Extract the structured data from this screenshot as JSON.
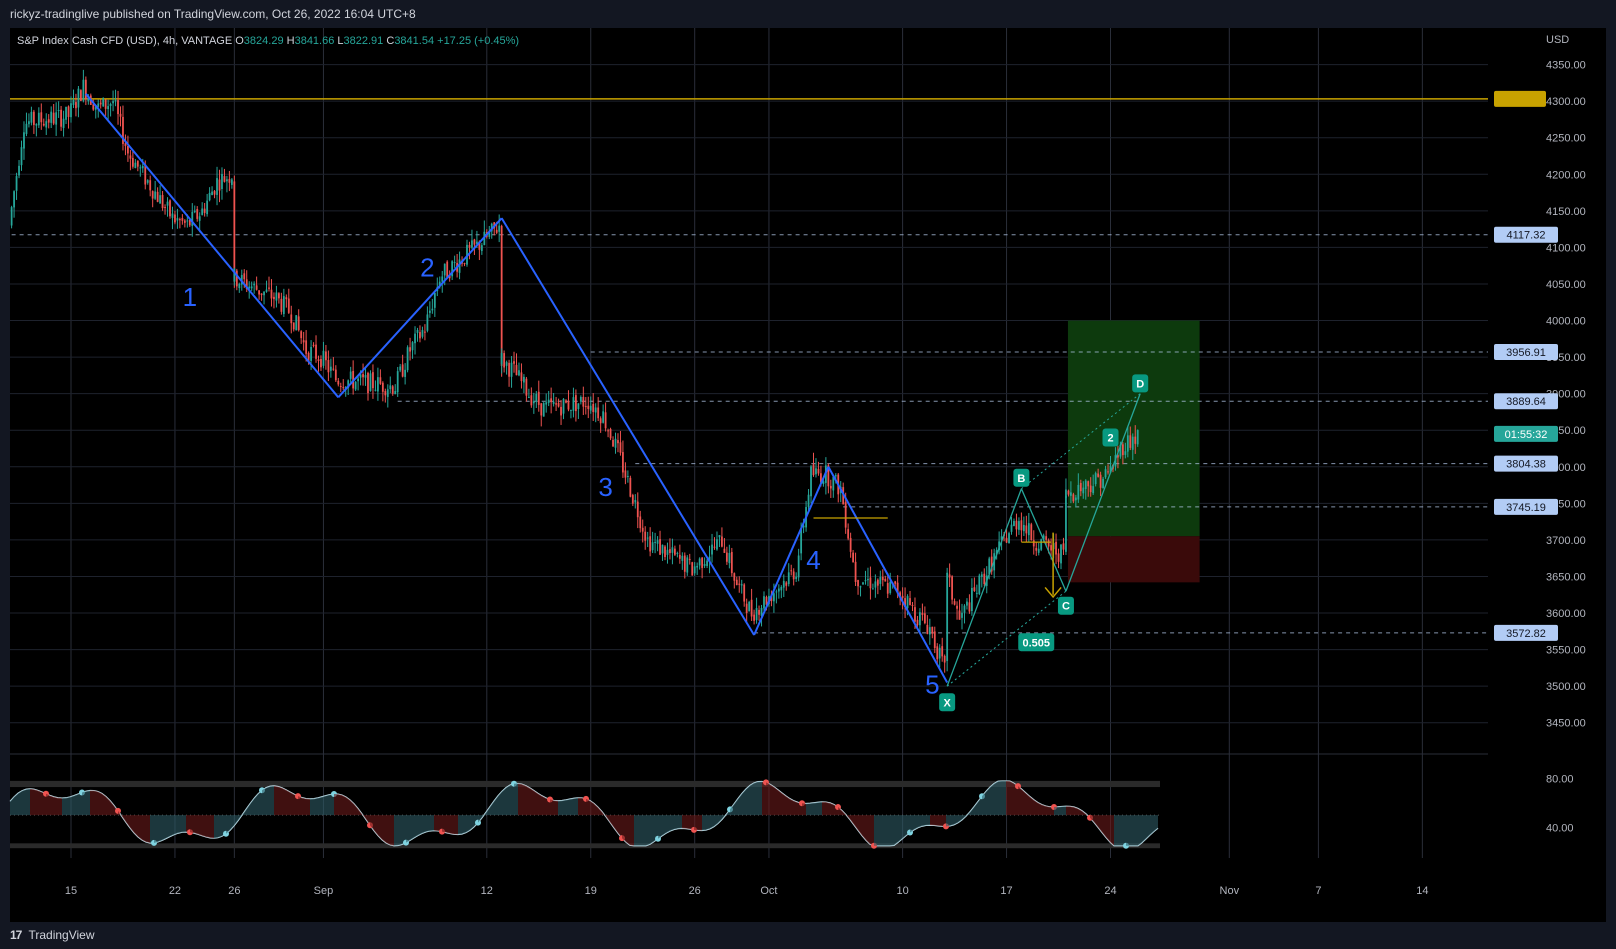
{
  "header": {
    "publish_text": "rickyz-tradinglive published on TradingView.com, Oct 26, 2022 16:04 UTC+8"
  },
  "footer": {
    "brand": "TradingView"
  },
  "legend": {
    "symbol": "S&P Index Cash CFD (USD), 4h, VANTAGE",
    "open_label": "O",
    "open": "3824.29",
    "high_label": "H",
    "high": "3841.66",
    "low_label": "L",
    "low": "3822.91",
    "close_label": "C",
    "close": "3841.54",
    "change": "+17.25 (+0.45%)"
  },
  "colors": {
    "background": "#000000",
    "up": "#26a69a",
    "down": "#ef5350",
    "wave_line": "#2962ff",
    "horizontal_gold": "#c8a200",
    "dashed_level": "#b2c7e8",
    "green_zone": "#0d3a0d",
    "red_zone": "#3a0a0a",
    "label_green": "#089981"
  },
  "chart_data": {
    "type": "candlestick",
    "currency": "USD",
    "y_ticks": [
      "4350.00",
      "4300.00",
      "4250.00",
      "4200.00",
      "4150.00",
      "4100.00",
      "4050.00",
      "4000.00",
      "3950.00",
      "3900.00",
      "3850.00",
      "3800.00",
      "3750.00",
      "3700.00",
      "3650.00",
      "3600.00",
      "3550.00",
      "3500.00",
      "3450.00"
    ],
    "ylim": [
      3410,
      4400
    ],
    "x_ticks": [
      "15",
      "22",
      "26",
      "Sep",
      "12",
      "19",
      "26",
      "Oct",
      "10",
      "17",
      "24",
      "Nov",
      "7",
      "14"
    ],
    "price_path": [
      [
        "Aug 11",
        4130
      ],
      [
        "Aug 12",
        4270
      ],
      [
        "Aug 15",
        4280
      ],
      [
        "Aug 16",
        4320
      ],
      [
        "Aug 17",
        4290
      ],
      [
        "Aug 18",
        4300
      ],
      [
        "Aug 19",
        4230
      ],
      [
        "Aug 22",
        4140
      ],
      [
        "Aug 23",
        4130
      ],
      [
        "Aug 24",
        4150
      ],
      [
        "Aug 25",
        4190
      ],
      [
        "Aug 26",
        4200
      ],
      [
        "Aug 26",
        4060
      ],
      [
        "Aug 29",
        4030
      ],
      [
        "Aug 30",
        4010
      ],
      [
        "Aug 31",
        3960
      ],
      [
        "Sep 1",
        3950
      ],
      [
        "Sep 2",
        3920
      ],
      [
        "Sep 6",
        3910
      ],
      [
        "Sep 7",
        3960
      ],
      [
        "Sep 8",
        3990
      ],
      [
        "Sep 9",
        4060
      ],
      [
        "Sep 12",
        4110
      ],
      [
        "Sep 13",
        4130
      ],
      [
        "Sep 13",
        3950
      ],
      [
        "Sep 14",
        3930
      ],
      [
        "Sep 15",
        3900
      ],
      [
        "Sep 16",
        3880
      ],
      [
        "Sep 19",
        3890
      ],
      [
        "Sep 20",
        3870
      ],
      [
        "Sep 21",
        3820
      ],
      [
        "Sep 22",
        3760
      ],
      [
        "Sep 23",
        3700
      ],
      [
        "Sep 26",
        3660
      ],
      [
        "Sep 27",
        3680
      ],
      [
        "Sep 28",
        3700
      ],
      [
        "Sep 29",
        3640
      ],
      [
        "Sep 30",
        3600
      ],
      [
        "Oct 3",
        3660
      ],
      [
        "Oct 4",
        3790
      ],
      [
        "Oct 5",
        3790
      ],
      [
        "Oct 6",
        3770
      ],
      [
        "Oct 7",
        3650
      ],
      [
        "Oct 10",
        3630
      ],
      [
        "Oct 11",
        3600
      ],
      [
        "Oct 12",
        3580
      ],
      [
        "Oct 13",
        3520
      ],
      [
        "Oct 13",
        3660
      ],
      [
        "Oct 14",
        3590
      ],
      [
        "Oct 17",
        3700
      ],
      [
        "Oct 18",
        3730
      ],
      [
        "Oct 19",
        3700
      ],
      [
        "Oct 20",
        3690
      ],
      [
        "Oct 21",
        3680
      ],
      [
        "Oct 21",
        3760
      ],
      [
        "Oct 24",
        3790
      ],
      [
        "Oct 25",
        3830
      ],
      [
        "Oct 26",
        3841.54
      ]
    ],
    "wave_labels": [
      {
        "text": "1",
        "date": "Aug 23",
        "price": 4020
      },
      {
        "text": "2",
        "date": "Sep 8",
        "price": 4060
      },
      {
        "text": "3",
        "date": "Sep 20",
        "price": 3760
      },
      {
        "text": "4",
        "date": "Oct 4",
        "price": 3660
      },
      {
        "text": "5",
        "date": "Oct 12",
        "price": 3490
      }
    ],
    "wave_lines": [
      [
        [
          "Aug 16",
          4310
        ],
        [
          "Sep 2",
          3895
        ]
      ],
      [
        [
          "Sep 2",
          3895
        ],
        [
          "Sep 13",
          4140
        ]
      ],
      [
        [
          "Sep 13",
          4140
        ],
        [
          "Sep 30",
          3570
        ]
      ],
      [
        [
          "Sep 30",
          3570
        ],
        [
          "Oct 5",
          3800
        ]
      ],
      [
        [
          "Oct 5",
          3800
        ],
        [
          "Oct 13",
          3505
        ]
      ]
    ],
    "levels": [
      {
        "label": "4117.32",
        "price": 4117.32
      },
      {
        "label": "3956.91",
        "price": 3956.91
      },
      {
        "label": "3889.64",
        "price": 3889.64
      },
      {
        "label": "3804.38",
        "price": 3804.38
      },
      {
        "label": "3745.19",
        "price": 3745.19
      },
      {
        "label": "3572.82",
        "price": 3572.82
      }
    ],
    "gold_level": 4303,
    "countdown_label": "01:55:32",
    "countdown_price": 3845,
    "pattern_labels": [
      {
        "text": "B",
        "date": "Oct 18",
        "price": 3785
      },
      {
        "text": "C",
        "date": "Oct 21",
        "price": 3610
      },
      {
        "text": "2",
        "date": "Oct 24",
        "price": 3840
      },
      {
        "text": "D",
        "date": "Oct 26",
        "price": 3914
      },
      {
        "text": "0.505",
        "date": "Oct 19",
        "price": 3560
      },
      {
        "text": "X",
        "date": "Oct 13",
        "price": 3478
      }
    ],
    "oscillator_ticks": [
      "80.00",
      "40.00"
    ],
    "oscillator_range": [
      15,
      100
    ]
  }
}
